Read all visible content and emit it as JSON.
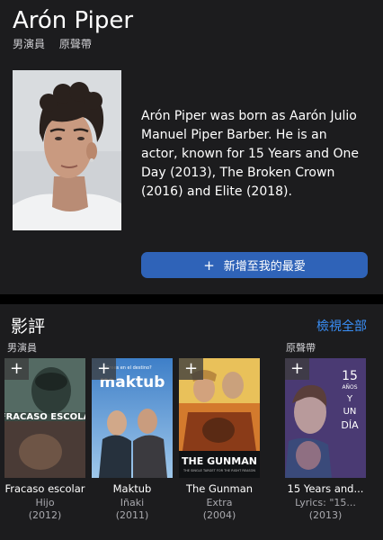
{
  "profile": {
    "name": "Arón Piper",
    "roles": [
      "男演員",
      "原聲帶"
    ],
    "bio": "Arón Piper was born as Aarón Julio Manuel Piper Barber. He is an actor, known for 15 Years and One Day (2013), The Broken Crown (2016) and Elite (2018).",
    "favorite_button": {
      "icon": "+",
      "label": "新增至我的最愛"
    }
  },
  "filmography": {
    "title": "影評",
    "see_all": "檢視全部",
    "group_labels": {
      "actor": "男演員",
      "soundtrack": "原聲帶"
    },
    "films": [
      {
        "title": "Fracaso escolar",
        "role": "Hijo",
        "year": "(2012)",
        "poster_text": "FRACASO ESCOLA"
      },
      {
        "title": "Maktub",
        "role": "Iñaki",
        "year": "(2011)",
        "poster_text": "maktub",
        "poster_tagline": "¿Crees en el destino?"
      },
      {
        "title": "The Gunman",
        "role": "Extra",
        "year": "(2004)",
        "poster_text": "THE GUNMAN",
        "poster_tagline": "THE SINGLE TARGET FOR THE RIGHT REASON"
      },
      {
        "title": "15 Years and...",
        "role": "Lyrics: \"15...",
        "year": "(2013)",
        "poster_text": [
          "15",
          "AÑOS",
          "Y",
          "UN",
          "DÍA"
        ]
      }
    ],
    "add_icon": "+"
  },
  "colors": {
    "background": "#1c1c1e",
    "accent": "#3a8ff7",
    "button": "#2f63b8"
  }
}
